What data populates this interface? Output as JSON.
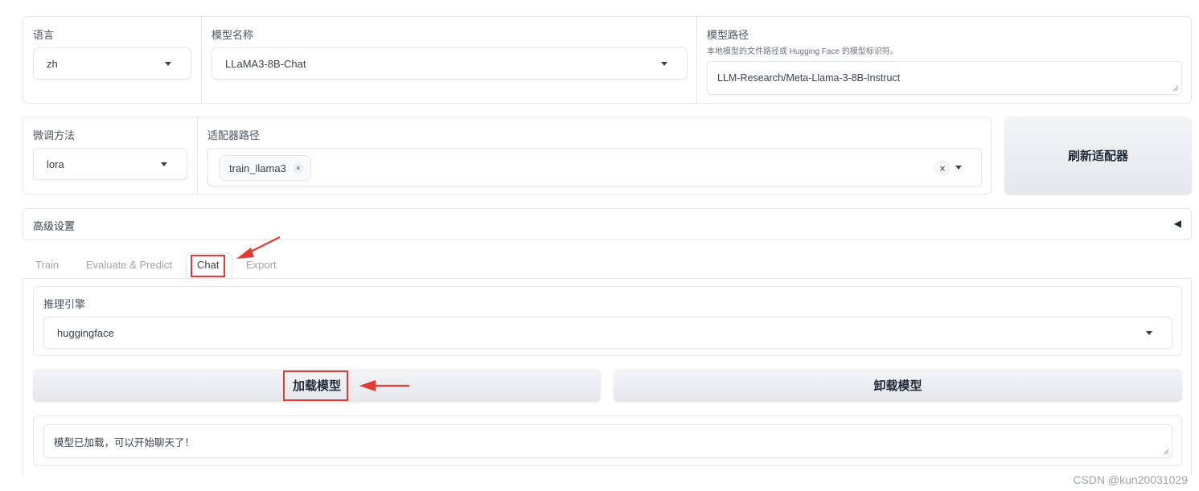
{
  "row1": {
    "language": {
      "label": "语言",
      "value": "zh"
    },
    "model_name": {
      "label": "模型名称",
      "value": "LLaMA3-8B-Chat"
    },
    "model_path": {
      "label": "模型路径",
      "hint": "本地模型的文件路径或 Hugging Face 的模型标识符。",
      "value": "LLM-Research/Meta-Llama-3-8B-Instruct"
    }
  },
  "row2": {
    "finetune": {
      "label": "微调方法",
      "value": "lora"
    },
    "adapter": {
      "label": "适配器路径",
      "chip": "train_llama3",
      "chip_remove": "×",
      "clear": "×"
    },
    "refresh_label": "刷新适配器"
  },
  "advanced": {
    "label": "高级设置",
    "toggle": "◀"
  },
  "tabs": [
    {
      "label": "Train",
      "active": false
    },
    {
      "label": "Evaluate & Predict",
      "active": false
    },
    {
      "label": "Chat",
      "active": true
    },
    {
      "label": "Export",
      "active": false
    }
  ],
  "chat": {
    "engine": {
      "label": "推理引擎",
      "value": "huggingface"
    },
    "load_label": "加载模型",
    "unload_label": "卸载模型",
    "status": "模型已加载，可以开始聊天了！"
  },
  "watermark": "CSDN @kun20031029",
  "colors": {
    "annotation_red": "#e53935",
    "border": "#e5e7eb",
    "button_bg": "#e5e7eb"
  }
}
